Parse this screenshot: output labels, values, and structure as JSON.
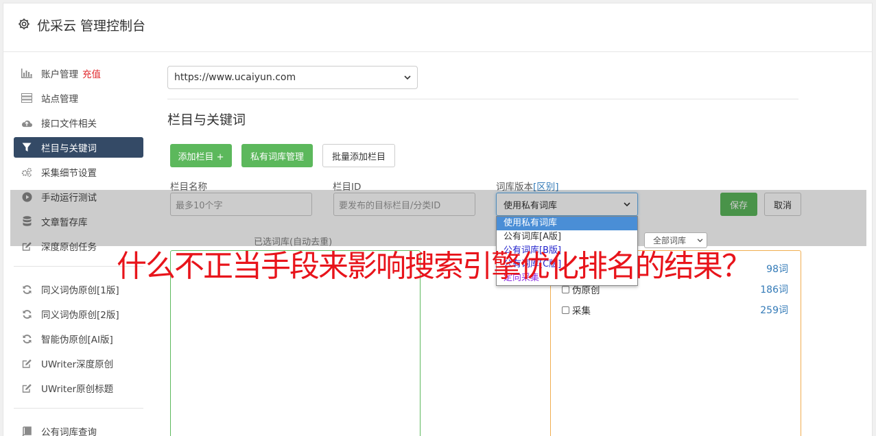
{
  "header": {
    "title": "优采云 管理控制台",
    "icon": "gear-icon"
  },
  "sidebar": {
    "items": [
      {
        "label": "账户管理",
        "badge": "充值",
        "icon": "bar-chart-icon"
      },
      {
        "label": "站点管理",
        "icon": "server-icon"
      },
      {
        "label": "接口文件相关",
        "icon": "cloud-upload-icon"
      },
      {
        "label": "栏目与关键词",
        "icon": "filter-icon",
        "active": true
      },
      {
        "label": "采集细节设置",
        "icon": "cogs-icon"
      },
      {
        "label": "手动运行测试",
        "icon": "play-circle-icon"
      },
      {
        "label": "文章暂存库",
        "icon": "database-icon"
      },
      {
        "label": "深度原创任务",
        "icon": "edit-icon"
      },
      {
        "label": "同义词伪原创[1版]",
        "icon": "refresh-icon"
      },
      {
        "label": "同义词伪原创[2版]",
        "icon": "refresh-icon"
      },
      {
        "label": "智能伪原创[AI版]",
        "icon": "refresh-icon"
      },
      {
        "label": "UWriter深度原创",
        "icon": "edit-icon"
      },
      {
        "label": "UWriter原创标题",
        "icon": "edit-icon"
      },
      {
        "label": "公有词库查询",
        "icon": "book-icon"
      }
    ]
  },
  "main": {
    "site_select": "https://www.ucaiyun.com",
    "section_title": "栏目与关键词",
    "buttons": {
      "add_column": "添加栏目 +",
      "private_lib": "私有词库管理",
      "batch_add": "批量添加栏目",
      "save": "保存",
      "cancel": "取消"
    },
    "form": {
      "name_label": "栏目名称",
      "name_placeholder": "最多10个字",
      "id_label": "栏目ID",
      "id_placeholder": "要发布的目标栏目/分类ID",
      "version_label": "词库版本",
      "version_link": "[区别]",
      "version_value": "使用私有词库"
    },
    "dropdown_options": [
      "使用私有词库",
      "公有词库[A版]",
      "公有词库[B版]",
      "公有词库[C版]",
      "定向采集"
    ],
    "selected_title": "已选词库(自动去重)",
    "filter_value": "全部词库",
    "libraries": [
      {
        "name": "",
        "count": "98词"
      },
      {
        "name": "伪原创",
        "count": "186词"
      },
      {
        "name": "采集",
        "count": "259词"
      }
    ]
  },
  "watermark": "什么不正当手段来影响搜索引擎优化排名的结果？"
}
